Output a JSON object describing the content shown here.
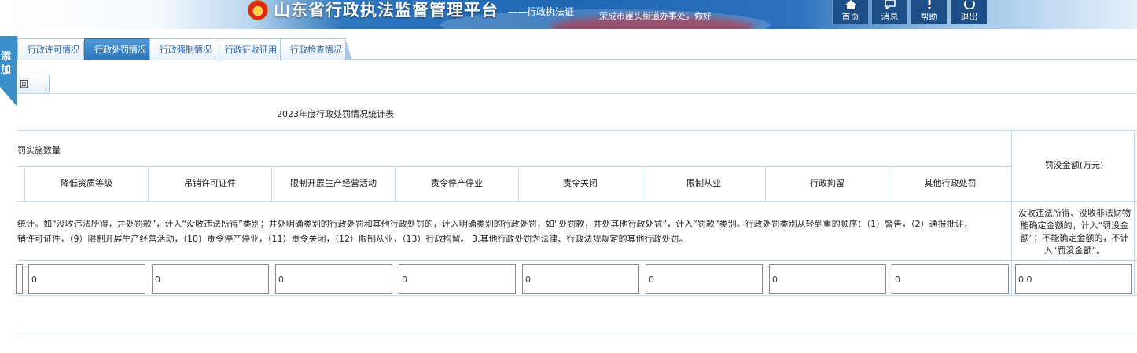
{
  "header": {
    "title": "山东省行政执法监督管理平台",
    "subtitle": "——行政执法证",
    "welcome": "荣成市崖头街道办事处，你好",
    "nav": [
      {
        "label": "首页",
        "icon": "home-icon"
      },
      {
        "label": "消息",
        "icon": "message-icon"
      },
      {
        "label": "帮助",
        "icon": "help-icon"
      },
      {
        "label": "退出",
        "icon": "power-icon"
      }
    ]
  },
  "side_tab": {
    "label_1": "添",
    "label_2": "加"
  },
  "tabs": [
    {
      "label": "行政许可情况",
      "active": false
    },
    {
      "label": "行政处罚情况",
      "active": true
    },
    {
      "label": "行政强制情况",
      "active": false
    },
    {
      "label": "行政征收征用",
      "active": false
    },
    {
      "label": "行政检查情况",
      "active": false
    }
  ],
  "toolbar": {
    "back_label": "回"
  },
  "form": {
    "caption": "2023年度行政处罚情况统计表",
    "group_header": "罚实施数量",
    "columns": [
      "降低资质等级",
      "吊销许可证件",
      "限制开展生产经营活动",
      "责令停产停业",
      "责令关闭",
      "限制从业",
      "行政拘留",
      "其他行政处罚"
    ],
    "amount_header": "罚没金额(万元)",
    "note_line1": "统计。如“没收违法所得，并处罚款”，计入“没收违法所得”类别；并处明确类别的行政处罚和其他行政处罚的，计入明确类别的行政处罚，如“处罚款，并处其他行政处罚”，计入“罚款”类别。行政处罚类别从轻到重的顺序：（1）警告，（2）通报批评，",
    "note_line2": "销许可证件，（9）限制开展生产经营活动，（10）责令停产停业，（11）责令关闭，（12）限制从业，（13）行政拘留。 3.其他行政处罚为法律、行政法规规定的其他行政处罚。",
    "amount_note": "没收违法所得、没收非法财物能确定金额的，计入“罚没金额”；不能确定金额的，不计入“罚没金额”。",
    "values": [
      "0",
      "0",
      "0",
      "0",
      "0",
      "0",
      "0",
      "0"
    ],
    "amount_value": "0.0"
  }
}
